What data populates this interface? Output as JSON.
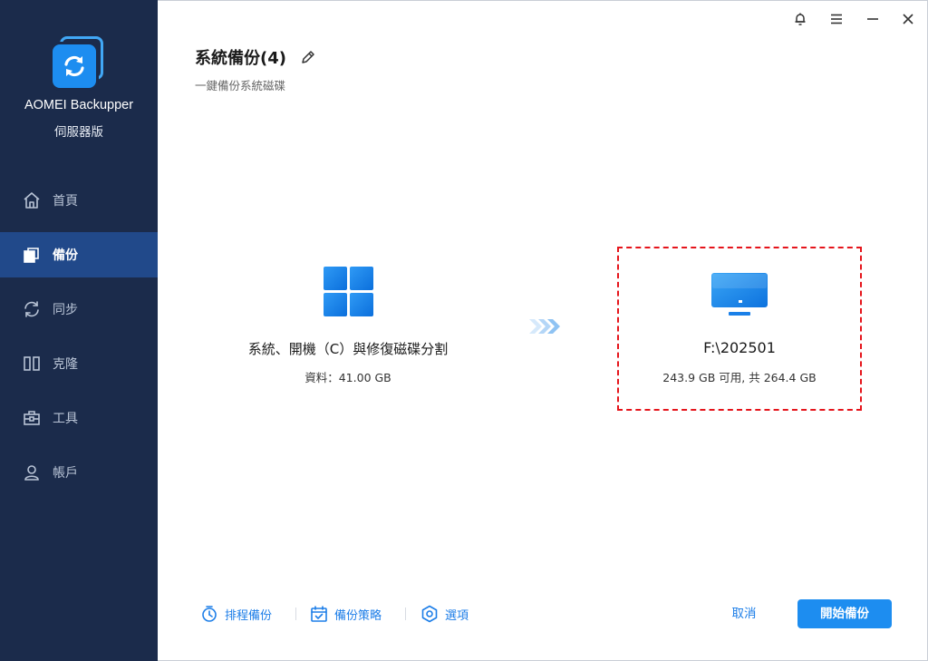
{
  "app": {
    "name": "AOMEI Backupper",
    "edition": "伺服器版",
    "logo_icon": "sync-backup-icon"
  },
  "titlebar": {
    "buttons": [
      "bell-icon",
      "menu-icon",
      "minimize-icon",
      "close-icon"
    ]
  },
  "sidebar": {
    "items": [
      {
        "label": "首頁",
        "icon": "home-icon"
      },
      {
        "label": "備份",
        "icon": "backup-icon",
        "active": true
      },
      {
        "label": "同步",
        "icon": "sync-icon"
      },
      {
        "label": "克隆",
        "icon": "clone-icon"
      },
      {
        "label": "工具",
        "icon": "toolbox-icon"
      },
      {
        "label": "帳戶",
        "icon": "user-icon"
      }
    ]
  },
  "header": {
    "title": "系統備份(4)",
    "subtitle": "一鍵備份系統磁碟"
  },
  "source": {
    "name": "系統、開機（C）與修復磁碟分割",
    "size": "資料：41.00 GB",
    "icon": "windows-icon"
  },
  "destination": {
    "path": "F:\\202501",
    "space": "243.9 GB 可用, 共 264.4 GB",
    "icon": "monitor-icon"
  },
  "footer": {
    "schedule_label": "排程備份",
    "scheme_label": "備份策略",
    "options_label": "選項",
    "cancel_label": "取消",
    "start_label": "開始備份"
  },
  "colors": {
    "sidebar_bg": "#1b2b4b",
    "sidebar_active": "#21498a",
    "accent": "#1d8df0",
    "highlight_border": "#e5141b"
  }
}
